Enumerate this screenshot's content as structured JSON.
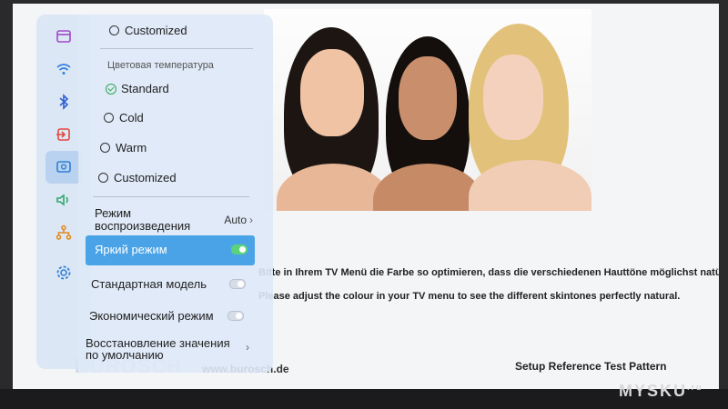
{
  "panel": {
    "top_option": "Customized",
    "section_title": "Цветовая температура",
    "temperature_options": [
      {
        "label": "Standard",
        "selected": true
      },
      {
        "label": "Cold",
        "selected": false
      },
      {
        "label": "Warm",
        "selected": false
      },
      {
        "label": "Customized",
        "selected": false
      }
    ],
    "playback": {
      "label_line1": "Режим",
      "label_line2": "воспроизведения",
      "value": "Auto"
    },
    "toggles": [
      {
        "label": "Яркий режим",
        "on": true,
        "highlighted": true
      },
      {
        "label": "Стандартная модель",
        "on": false
      },
      {
        "label": "Экономический режим",
        "on": false
      }
    ],
    "restore": {
      "line1": "Восстановление значения",
      "line2": "по умолчанию"
    }
  },
  "rail_icons": [
    "input-icon",
    "wifi-icon",
    "bluetooth-icon",
    "source-icon",
    "picture-icon",
    "sound-icon",
    "network-icon",
    "settings-gear-icon"
  ],
  "test_pattern": {
    "line_de": "Bitte in Ihrem TV Menü die Farbe so optimieren, dass die verschiedenen Hauttöne möglichst natürlich dargestellt werden.",
    "line_en": "Please adjust the colour in your TV menu to see the different skintones perfectly natural.",
    "site": "www.burosch.de",
    "setup": "Setup Reference Test Pattern",
    "logo": "BUROSCH"
  },
  "watermark": {
    "text": "MYSKU",
    "suffix": ".ru"
  },
  "colors": {
    "accent": "#4aa3e6",
    "toggle_on": "#5cd27a",
    "check": "#2ea84f"
  }
}
